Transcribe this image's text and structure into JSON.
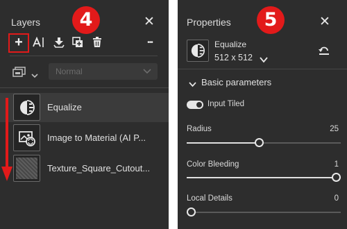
{
  "layers_panel": {
    "title": "Layers",
    "close_glyph": "✕",
    "badge": "4",
    "toolbar": {
      "add_glyph": "+",
      "more_glyph": "•••",
      "icons": [
        "add-layer-icon",
        "text-layer-icon",
        "import-icon",
        "duplicate-icon",
        "delete-icon",
        "more-icon"
      ]
    },
    "blend_select": {
      "value": "Normal"
    },
    "layers": [
      {
        "label": "Equalize",
        "icon": "equalize-icon",
        "selected": true
      },
      {
        "label": "Image to Material (AI P...",
        "icon": "image-to-material-icon",
        "selected": false
      },
      {
        "label": "Texture_Square_Cutout...",
        "icon": "texture-thumbnail",
        "selected": false
      }
    ]
  },
  "properties_panel": {
    "title": "Properties",
    "close_glyph": "✕",
    "badge": "5",
    "filter": {
      "name": "Equalize",
      "size": "512 x 512"
    },
    "section": {
      "title": "Basic parameters"
    },
    "toggle": {
      "label": "Input Tiled",
      "on": true
    },
    "params": [
      {
        "label": "Radius",
        "value": "25",
        "fraction": 0.47
      },
      {
        "label": "Color Bleeding",
        "value": "1",
        "fraction": 1.0
      },
      {
        "label": "Local Details",
        "value": "0",
        "fraction": 0.0
      }
    ]
  },
  "colors": {
    "panel_bg": "#2d2d2d",
    "selected_row": "#3b3b3b",
    "annotation_red": "#e21a1a"
  }
}
